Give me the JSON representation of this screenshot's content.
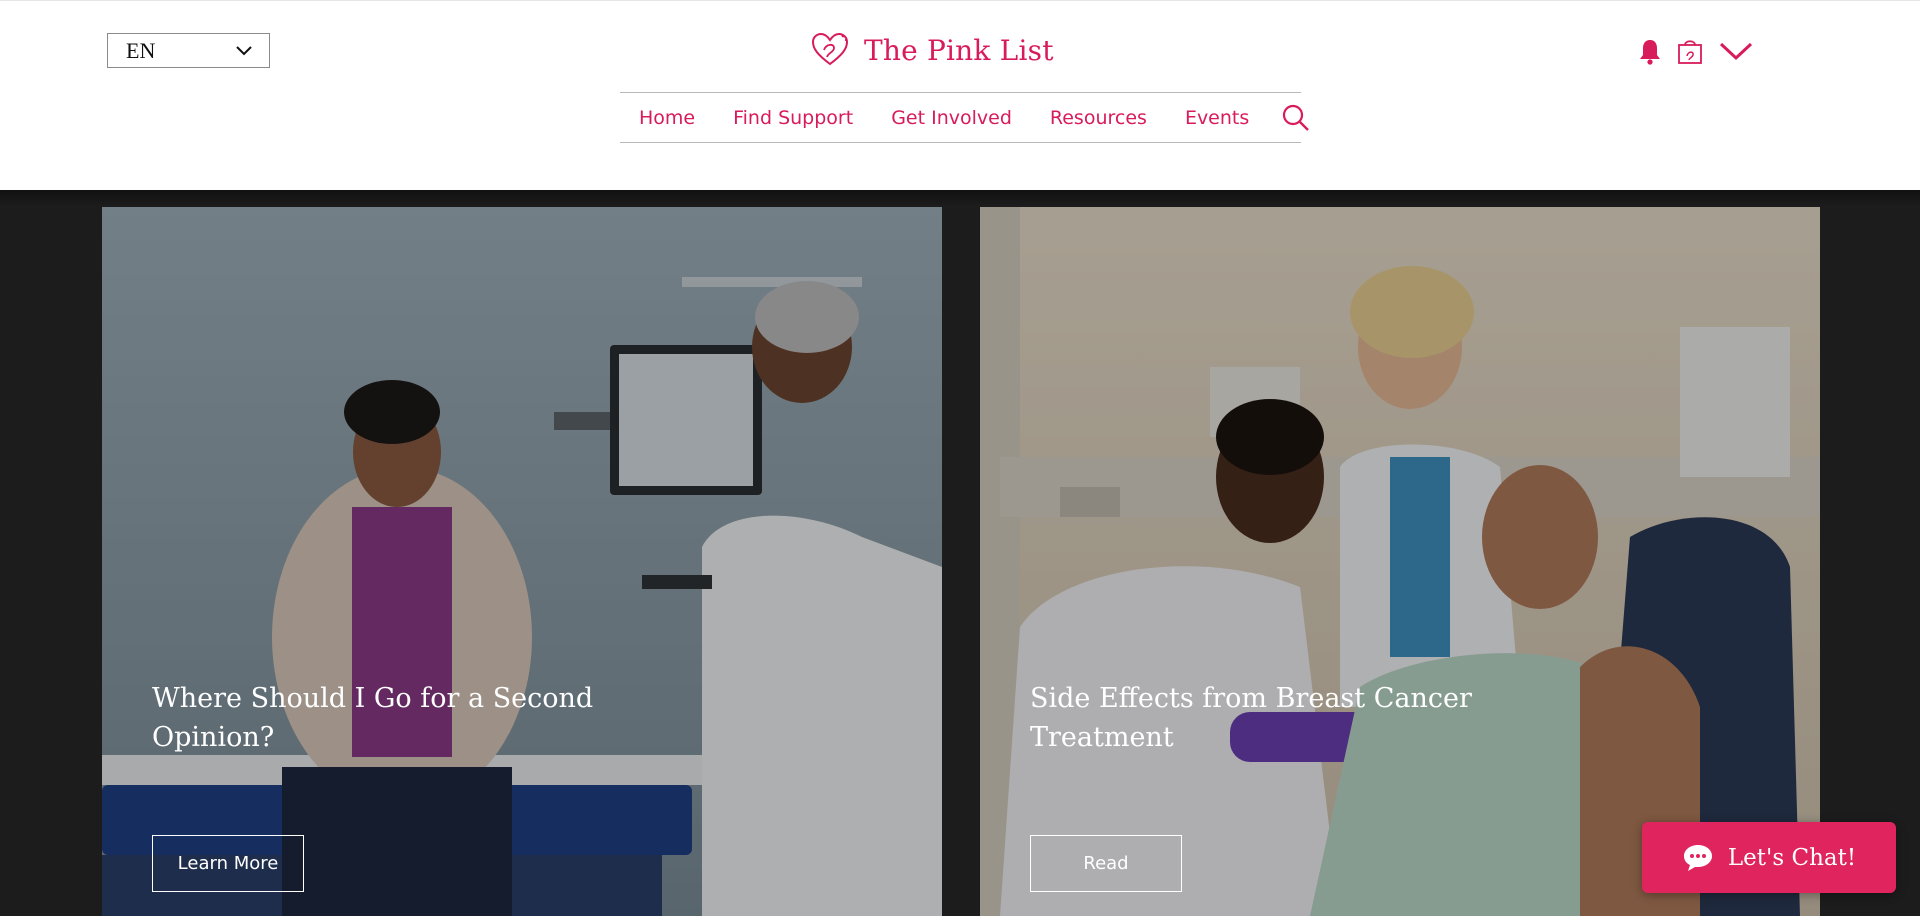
{
  "header": {
    "language": "EN",
    "brand_name": "The Pink List",
    "nav": [
      {
        "label": "Home"
      },
      {
        "label": "Find Support"
      },
      {
        "label": "Get Involved"
      },
      {
        "label": "Resources"
      },
      {
        "label": "Events"
      }
    ],
    "icons": [
      "heart-logo-icon",
      "bell-icon",
      "shopping-bag-icon",
      "chevron-down-icon",
      "search-icon"
    ]
  },
  "cards": [
    {
      "title": "Where Should I Go for a Second Opinion?",
      "button_label": "Learn More",
      "image": "patient-talking-with-doctor-photo"
    },
    {
      "title": "Side Effects from Breast Cancer Treatment",
      "button_label": "Read",
      "image": "patient-receiving-treatment-photo"
    }
  ],
  "chat": {
    "label": "Let's Chat!",
    "icon": "chat-bubble-icon"
  },
  "colors": {
    "brand_pink": "#d81b5a",
    "chat_pink": "#e0245e",
    "band_dark": "#1c1c1c"
  }
}
